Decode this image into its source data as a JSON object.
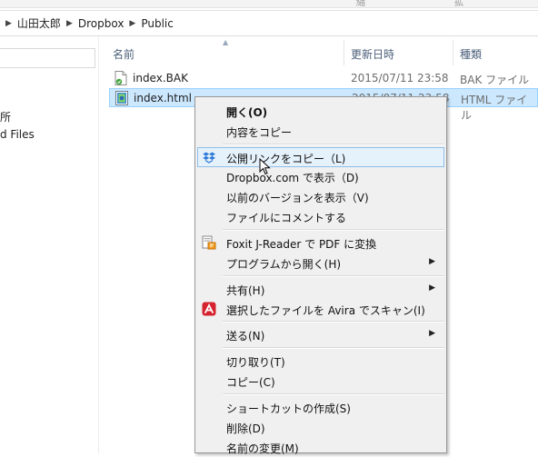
{
  "window": {
    "partial_header_cols": [
      "縮",
      "拡"
    ]
  },
  "breadcrumb": {
    "items": [
      "山田太郎",
      "Dropbox",
      "Public"
    ]
  },
  "nav": {
    "items": [
      "所",
      "d Files"
    ]
  },
  "columns": {
    "name": "名前",
    "date": "更新日時",
    "type": "種類"
  },
  "files": [
    {
      "name": "index.BAK",
      "date": "2015/07/11 23:58",
      "type": "BAK ファイル",
      "icon": "bak-file-icon"
    },
    {
      "name": "index.html",
      "date": "2015/07/11 23:58",
      "type": "HTML ファイル",
      "icon": "html-file-icon"
    }
  ],
  "context_menu": {
    "items": [
      {
        "label": "開く(O)",
        "bold": true
      },
      {
        "label": "内容をコピー"
      },
      {
        "label": "公開リンクをコピー（L)",
        "icon": "dropbox-icon",
        "highlighted": true
      },
      {
        "label": "Dropbox.com で表示（D)"
      },
      {
        "label": "以前のバージョンを表示（V)"
      },
      {
        "label": "ファイルにコメントする"
      },
      {
        "label": "Foxit J-Reader で PDF に変換",
        "icon": "foxit-icon"
      },
      {
        "label": "プログラムから開く(H)",
        "submenu": true
      },
      {
        "label": "共有(H)",
        "submenu": true
      },
      {
        "label": "選択したファイルを Avira でスキャン(I)",
        "icon": "avira-icon"
      },
      {
        "label": "送る(N)",
        "submenu": true
      },
      {
        "label": "切り取り(T)"
      },
      {
        "label": "コピー(C)"
      },
      {
        "label": "ショートカットの作成(S)"
      },
      {
        "label": "削除(D)"
      },
      {
        "label": "名前の変更(M)"
      }
    ]
  },
  "colors": {
    "selection": "#cce8ff",
    "menu_highlight": "#e5f1fb",
    "avira_red": "#d5232f"
  }
}
